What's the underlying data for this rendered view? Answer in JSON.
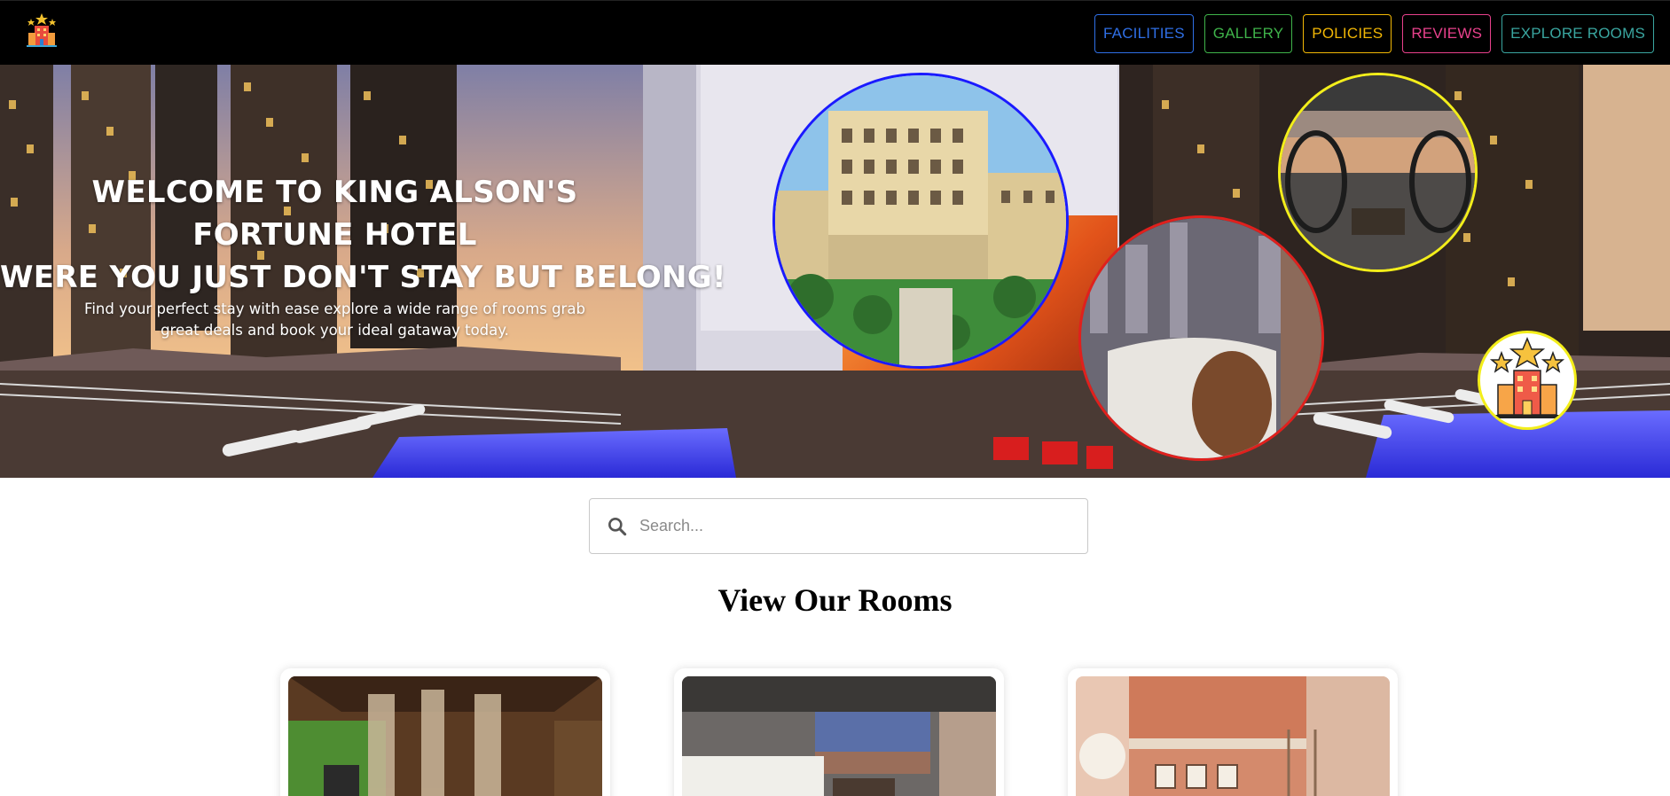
{
  "navbar": {
    "logo_icon": "hotel-stars-icon",
    "links": [
      {
        "label": "FACILITIES",
        "color": "#2f6fe6"
      },
      {
        "label": "GALLERY",
        "color": "#3fb34a"
      },
      {
        "label": "POLICIES",
        "color": "#f2b705"
      },
      {
        "label": "REVIEWS",
        "color": "#e8418c"
      },
      {
        "label": "EXPLORE ROOMS",
        "color": "#3aa6a0"
      }
    ]
  },
  "hero": {
    "title_line1": "WELCOME TO KING ALSON'S FORTUNE HOTEL",
    "title_line2": "WERE YOU JUST DON'T STAY BUT BELONG!",
    "subtitle": "Find your perfect stay with ease explore a wide range of rooms grab great deals and book your ideal gataway today.",
    "circle_colors": {
      "hotel": "#1a1aff",
      "lounge": "#f3ee1a",
      "bath": "#e0201d",
      "badge": "#f3ee1a"
    }
  },
  "search": {
    "icon": "search-icon",
    "placeholder": "Search..."
  },
  "rooms": {
    "title": "View Our Rooms"
  }
}
